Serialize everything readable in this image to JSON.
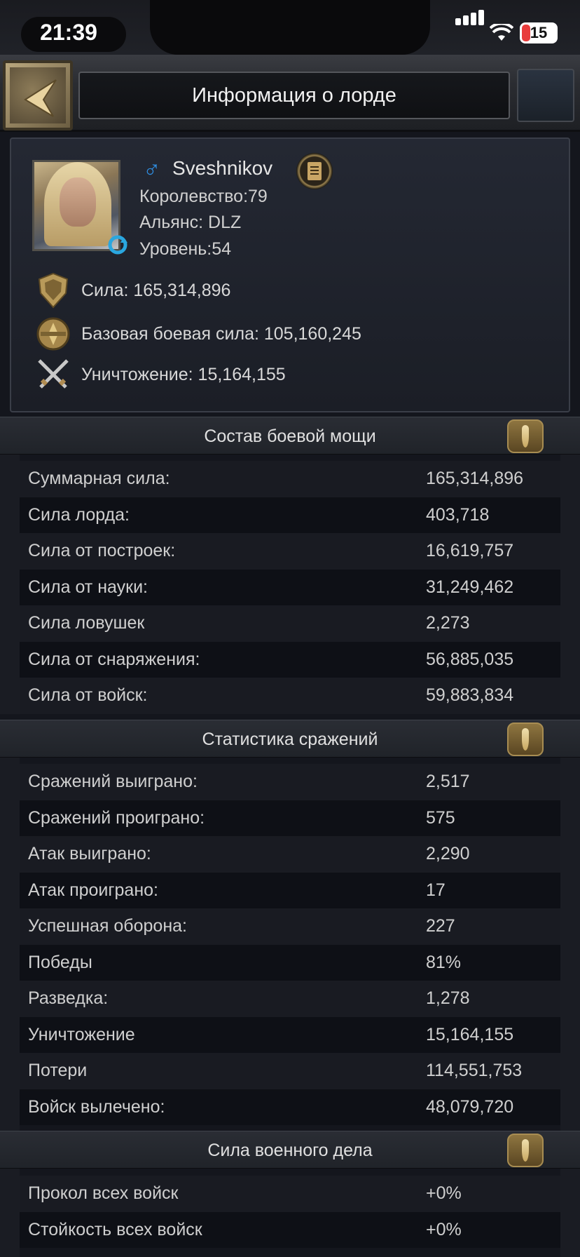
{
  "status_bar": {
    "time": "21:39",
    "battery": "15",
    "signal_icon": "signal-bars-icon",
    "wifi_icon": "wifi-icon"
  },
  "header": {
    "title": "Информация о лорде",
    "back_icon": "back-arrow-icon"
  },
  "profile": {
    "name": "Sveshnikov",
    "gender_symbol": "♂",
    "kingdom": "Королевство:79",
    "alliance": "Альянс: DLZ",
    "level": "Уровень:54",
    "power": "Сила: 165,314,896",
    "base_power": "Базовая боевая сила: 105,160,245",
    "kills": "Уничтожение: 15,164,155"
  },
  "sections": [
    {
      "title": "Состав боевой мощи",
      "rows": [
        {
          "label": "Суммарная сила:",
          "value": "165,314,896"
        },
        {
          "label": "Сила лорда:",
          "value": "403,718"
        },
        {
          "label": "Сила от построек:",
          "value": "16,619,757"
        },
        {
          "label": "Сила от науки:",
          "value": "31,249,462"
        },
        {
          "label": "Сила ловушек",
          "value": "2,273"
        },
        {
          "label": "Сила от снаряжения:",
          "value": "56,885,035"
        },
        {
          "label": "Сила от войск:",
          "value": "59,883,834"
        }
      ]
    },
    {
      "title": "Статистика сражений",
      "rows": [
        {
          "label": "Сражений выиграно:",
          "value": "2,517"
        },
        {
          "label": "Сражений проиграно:",
          "value": "575"
        },
        {
          "label": "Атак выиграно:",
          "value": "2,290"
        },
        {
          "label": "Атак проиграно:",
          "value": "17"
        },
        {
          "label": "Успешная оборона:",
          "value": "227"
        },
        {
          "label": "Победы",
          "value": "81%"
        },
        {
          "label": "Разведка:",
          "value": "1,278"
        },
        {
          "label": "Уничтожение",
          "value": "15,164,155"
        },
        {
          "label": "Потери",
          "value": "114,551,753"
        },
        {
          "label": "Войск вылечено:",
          "value": "48,079,720"
        }
      ]
    },
    {
      "title": "Сила военного дела",
      "rows": [
        {
          "label": "Прокол всех войск",
          "value": "+0%"
        },
        {
          "label": "Стойкость всех войск",
          "value": "+0%"
        }
      ]
    }
  ]
}
